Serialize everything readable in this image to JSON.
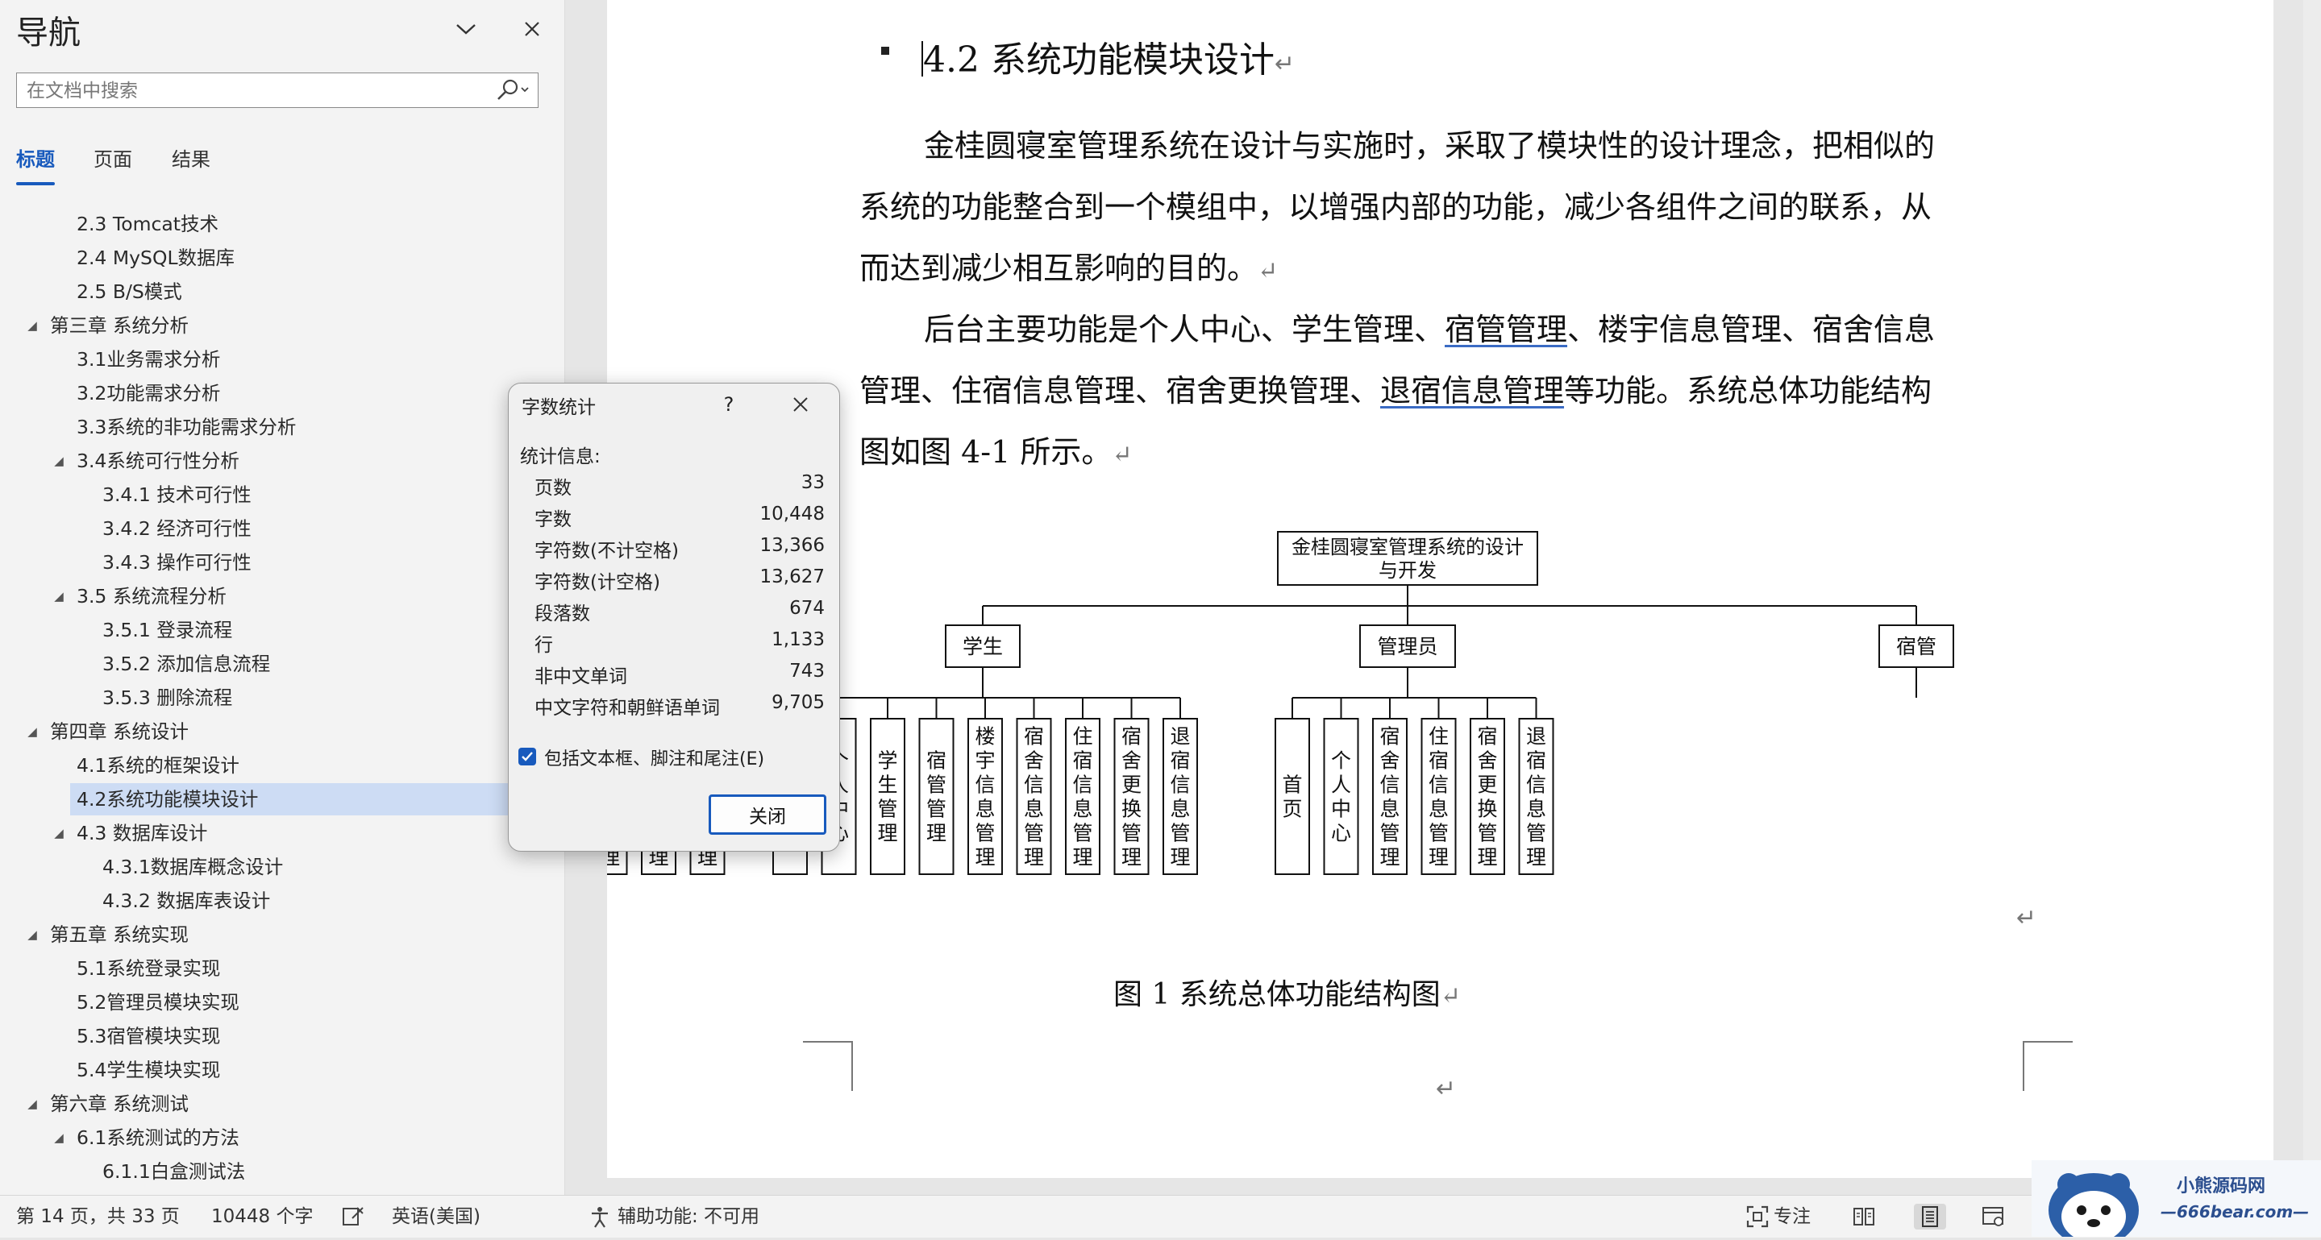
{
  "nav": {
    "title": "导航",
    "search_placeholder": "在文档中搜索",
    "tabs": [
      "标题",
      "页面",
      "结果"
    ],
    "items": [
      {
        "label": "2.3 Tomcat技术",
        "level": 2
      },
      {
        "label": "2.4 MySQL数据库",
        "level": 2
      },
      {
        "label": "2.5 B/S模式",
        "level": 2
      },
      {
        "label": "第三章 系统分析",
        "level": 1,
        "expanded": true
      },
      {
        "label": "3.1业务需求分析",
        "level": 2
      },
      {
        "label": "3.2功能需求分析",
        "level": 2
      },
      {
        "label": "3.3系统的非功能需求分析",
        "level": 2
      },
      {
        "label": "3.4系统可行性分析",
        "level": 2,
        "expanded": true
      },
      {
        "label": "3.4.1 技术可行性",
        "level": 3
      },
      {
        "label": "3.4.2 经济可行性",
        "level": 3
      },
      {
        "label": "3.4.3 操作可行性",
        "level": 3
      },
      {
        "label": "3.5 系统流程分析",
        "level": 2,
        "expanded": true
      },
      {
        "label": "3.5.1 登录流程",
        "level": 3
      },
      {
        "label": "3.5.2 添加信息流程",
        "level": 3
      },
      {
        "label": "3.5.3 删除流程",
        "level": 3
      },
      {
        "label": "第四章 系统设计",
        "level": 1,
        "expanded": true
      },
      {
        "label": "4.1系统的框架设计",
        "level": 2
      },
      {
        "label": "4.2系统功能模块设计",
        "level": 2,
        "selected": true
      },
      {
        "label": "4.3 数据库设计",
        "level": 2,
        "expanded": true
      },
      {
        "label": "4.3.1数据库概念设计",
        "level": 3
      },
      {
        "label": "4.3.2 数据库表设计",
        "level": 3
      },
      {
        "label": "第五章 系统实现",
        "level": 1,
        "expanded": true
      },
      {
        "label": "5.1系统登录实现",
        "level": 2
      },
      {
        "label": "5.2管理员模块实现",
        "level": 2
      },
      {
        "label": "5.3宿管模块实现",
        "level": 2
      },
      {
        "label": "5.4学生模块实现",
        "level": 2
      },
      {
        "label": "第六章 系统测试",
        "level": 1,
        "expanded": true
      },
      {
        "label": "6.1系统测试的方法",
        "level": 2,
        "expanded": true
      },
      {
        "label": "6.1.1白盒测试法",
        "level": 3
      }
    ]
  },
  "doc": {
    "heading": "4.2 系统功能模块设计",
    "para1": [
      "金桂圆寝室管理系统在设计与实施时，采取了模块性的设计理念，把相似的",
      "系统的功能整合到一个模组中，以增强内部的功能，减少各组件之间的联系，从",
      "而达到减少相互影响的目的。"
    ],
    "para2": {
      "l1a": "后台主要功能是个人中心、学生管理、",
      "l1link": "宿管管理",
      "l1b": "、楼宇信息管理、宿舍信息",
      "l2a": "管理、住宿信息管理、宿舍更换管理、",
      "l2link": "退宿信息管理",
      "l2b": "等功能。系统总体功能结构",
      "l3": "图如图 4-1 所示。"
    },
    "caption": "图 1  系统总体功能结构图"
  },
  "chart_data": {
    "type": "tree",
    "root": {
      "line1": "金桂圆寝室管理系统的设计",
      "line2": "与开发"
    },
    "groups": [
      {
        "name": "学生",
        "children": [
          "首页",
          "个人中心",
          "宿舍信息管理",
          "住宿信息管理",
          "宿舍更换管理",
          "退宿信息管理"
        ]
      },
      {
        "name": "管理员",
        "children": [
          "首页",
          "个人中心",
          "学生管理",
          "宿管管理",
          "楼宇信息管理",
          "宿舍信息管理",
          "住宿信息管理",
          "宿舍更换管理",
          "退宿信息管理"
        ]
      },
      {
        "name": "宿管",
        "children": [
          "首页",
          "个人中心",
          "宿舍信息管理",
          "住宿信息管理",
          "宿舍更换管理",
          "退宿信息管理"
        ]
      }
    ]
  },
  "dialog": {
    "title": "字数统计",
    "help": "?",
    "subtitle": "统计信息:",
    "stats": [
      {
        "label": "页数",
        "value": "33"
      },
      {
        "label": "字数",
        "value": "10,448"
      },
      {
        "label": "字符数(不计空格)",
        "value": "13,366"
      },
      {
        "label": "字符数(计空格)",
        "value": "13,627"
      },
      {
        "label": "段落数",
        "value": "674"
      },
      {
        "label": "行",
        "value": "1,133"
      },
      {
        "label": "非中文单词",
        "value": "743"
      },
      {
        "label": "中文字符和朝鲜语单词",
        "value": "9,705"
      }
    ],
    "checkbox_label": "包括文本框、脚注和尾注(E)",
    "checkbox_checked": true,
    "close_label": "关闭"
  },
  "status": {
    "page": "第 14 页，共 33 页",
    "words": "10448 个字",
    "language": "英语(美国)",
    "accessibility": "辅助功能: 不可用",
    "focus": "专注"
  },
  "watermark": {
    "line1": "小熊源码网",
    "line2": "—666bear.com—"
  },
  "colors": {
    "accent": "#185abd",
    "selected_bg": "#cddcf4",
    "link_underline": "#3a6bc4"
  }
}
